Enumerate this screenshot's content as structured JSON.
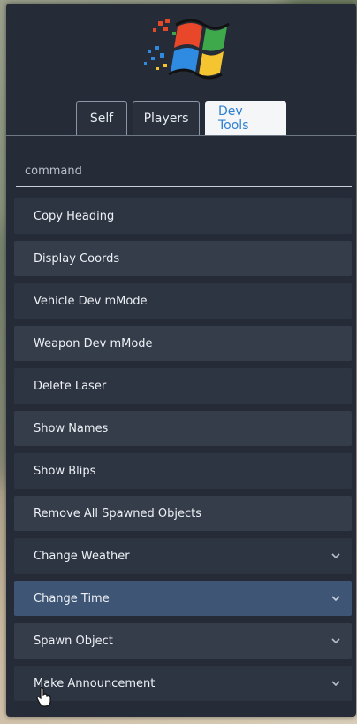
{
  "tabs": [
    {
      "label": "Self",
      "active": false
    },
    {
      "label": "Players",
      "active": false
    },
    {
      "label": "Dev Tools",
      "active": true
    }
  ],
  "search": {
    "placeholder": "command",
    "value": ""
  },
  "menu_items": [
    {
      "label": "Copy Heading",
      "has_submenu": false
    },
    {
      "label": "Display Coords",
      "has_submenu": false
    },
    {
      "label": "Vehicle Dev mMode",
      "has_submenu": false
    },
    {
      "label": "Weapon Dev mMode",
      "has_submenu": false
    },
    {
      "label": "Delete Laser",
      "has_submenu": false
    },
    {
      "label": "Show Names",
      "has_submenu": false
    },
    {
      "label": "Show Blips",
      "has_submenu": false
    },
    {
      "label": "Remove All Spawned Objects",
      "has_submenu": false
    },
    {
      "label": "Change Weather",
      "has_submenu": true
    },
    {
      "label": "Change Time",
      "has_submenu": true,
      "selected": true
    },
    {
      "label": "Spawn Object",
      "has_submenu": true
    },
    {
      "label": "Make Announcement",
      "has_submenu": true
    }
  ],
  "icons": {
    "logo": "windows-logo-icon",
    "submenu": "chevron-down-icon",
    "cursor": "mouse-cursor-icon"
  },
  "colors": {
    "panel": "#262c37",
    "item": "#2e3542",
    "item_alt": "#353d4b",
    "item_selected": "#3e5575",
    "active_tab_text": "#2f80d0"
  }
}
